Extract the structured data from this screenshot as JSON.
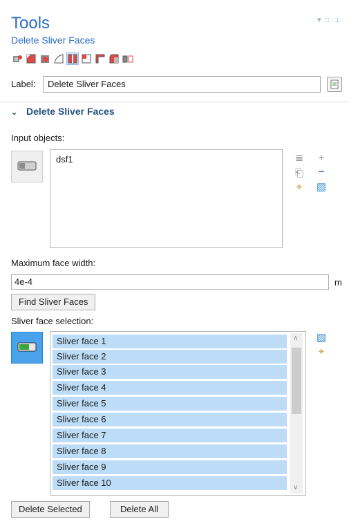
{
  "header": {
    "title": "Tools",
    "subtitle": "Delete Sliver Faces",
    "window_controls": [
      "▼",
      "□",
      "⊥"
    ]
  },
  "toolbar": {
    "icons": [
      "sweep-icon",
      "box-face-icon",
      "cylinder-face-icon",
      "wedge-icon",
      "split-face-icon",
      "block-corner-icon",
      "corner-icon",
      "round-box-icon",
      "split-pieces-icon"
    ],
    "selected_index": 4
  },
  "label_row": {
    "label": "Label:",
    "value": "Delete Sliver Faces"
  },
  "section": {
    "title": "Delete Sliver Faces"
  },
  "input_objects": {
    "caption": "Input objects:",
    "items": [
      "dsf1"
    ]
  },
  "max_width": {
    "caption": "Maximum face width:",
    "value": "4e-4",
    "unit": "m"
  },
  "find_button": "Find Sliver Faces",
  "sliver_selection": {
    "caption": "Sliver face selection:",
    "items": [
      "Sliver face 1",
      "Sliver face 2",
      "Sliver face 3",
      "Sliver face 4",
      "Sliver face 5",
      "Sliver face 6",
      "Sliver face 7",
      "Sliver face 8",
      "Sliver face 9",
      "Sliver face 10"
    ]
  },
  "buttons": {
    "delete_selected": "Delete Selected",
    "delete_all": "Delete All"
  },
  "colors": {
    "accent": "#2c6ec2",
    "section": "#27507f",
    "selection": "#bcdcf7",
    "active_button": "#4aa2ea"
  }
}
